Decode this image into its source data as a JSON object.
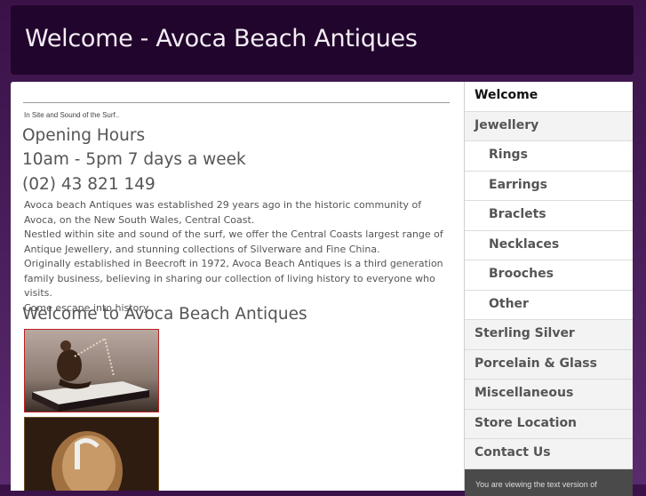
{
  "header": {
    "title": "Welcome - Avoca Beach Antiques"
  },
  "main": {
    "tagline": "In Site and Sound of the Surf..",
    "hours_title": "Opening Hours",
    "hours_time": "10am - 5pm 7 days a week",
    "phone": "(02) 43 821 149",
    "paragraphs": [
      "Avoca beach Antiques was established 29 years ago in the historic community of Avoca, on the New South Wales, Central Coast.",
      "Nestled within site and sound of the surf, we offer the Central Coasts largest range of Antique Jewellery, and stunning collections of Silverware and Fine China.",
      "Originally established in Beecroft in 1972, Avoca Beach Antiques is a third generation family business, believing in sharing our collection of living history to everyone who visits.",
      "Come escape into history..."
    ],
    "welcome_heading": "Welcome to Avoca Beach Antiques"
  },
  "sidebar": {
    "items": [
      {
        "label": "Welcome"
      },
      {
        "label": "Jewellery"
      },
      {
        "label": "Rings"
      },
      {
        "label": "Earrings"
      },
      {
        "label": "Braclets"
      },
      {
        "label": "Necklaces"
      },
      {
        "label": "Brooches"
      },
      {
        "label": "Other"
      },
      {
        "label": "Sterling Silver"
      },
      {
        "label": "Porcelain & Glass"
      },
      {
        "label": "Miscellaneous"
      },
      {
        "label": "Store Location"
      },
      {
        "label": "Contact Us"
      }
    ],
    "footer_text": "You are viewing the text version of"
  }
}
